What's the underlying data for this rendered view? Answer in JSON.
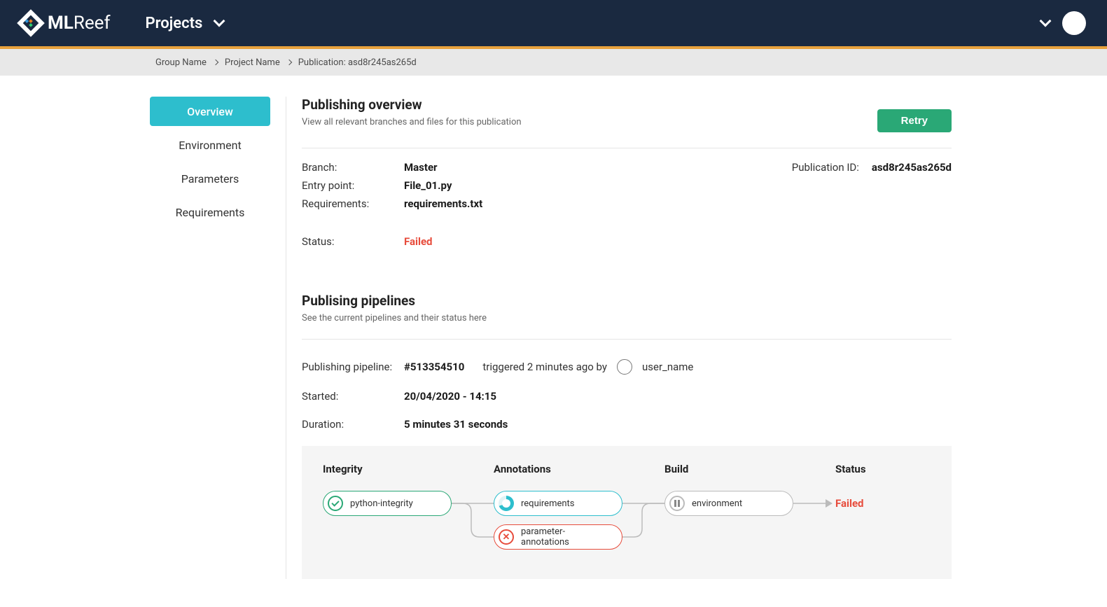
{
  "header": {
    "brand_prefix": "ML",
    "brand_suffix": "Reef",
    "nav_projects": "Projects"
  },
  "breadcrumb": {
    "group": "Group Name",
    "project": "Project Name",
    "page": "Publication: asd8r245as265d"
  },
  "sidebar": {
    "items": [
      {
        "label": "Overview",
        "active": true
      },
      {
        "label": "Environment",
        "active": false
      },
      {
        "label": "Parameters",
        "active": false
      },
      {
        "label": "Requirements",
        "active": false
      }
    ]
  },
  "overview": {
    "title": "Publishing overview",
    "subtitle": "View all relevant branches and files for this publication",
    "retry_label": "Retry",
    "branch_label": "Branch:",
    "branch_value": "Master",
    "entry_label": "Entry point:",
    "entry_value": "File_01.py",
    "req_label": "Requirements:",
    "req_value": "requirements.txt",
    "status_label": "Status:",
    "status_value": "Failed",
    "pubid_label": "Publication ID:",
    "pubid_value": "asd8r245as265d"
  },
  "pipelines": {
    "title": "Publising pipelines",
    "subtitle": "See the current pipelines and their status here",
    "pipeline_label": "Publishing pipeline:",
    "pipeline_value": "#513354510",
    "triggered_text": "triggered 2 minutes ago by",
    "username": "user_name",
    "started_label": "Started:",
    "started_value": "20/04/2020 - 14:15",
    "duration_label": "Duration:",
    "duration_value": "5 minutes 31 seconds"
  },
  "stages": {
    "col1": "Integrity",
    "col2": "Annotations",
    "col3": "Build",
    "col4": "Status",
    "job1": "python-integrity",
    "job2a": "requirements",
    "job2b": "parameter-annotations",
    "job3": "environment",
    "final_status": "Failed"
  },
  "colors": {
    "navy": "#1a2940",
    "orange": "#e8a13c",
    "teal": "#2dbecd",
    "green": "#2aa876",
    "red": "#e74c3c"
  }
}
